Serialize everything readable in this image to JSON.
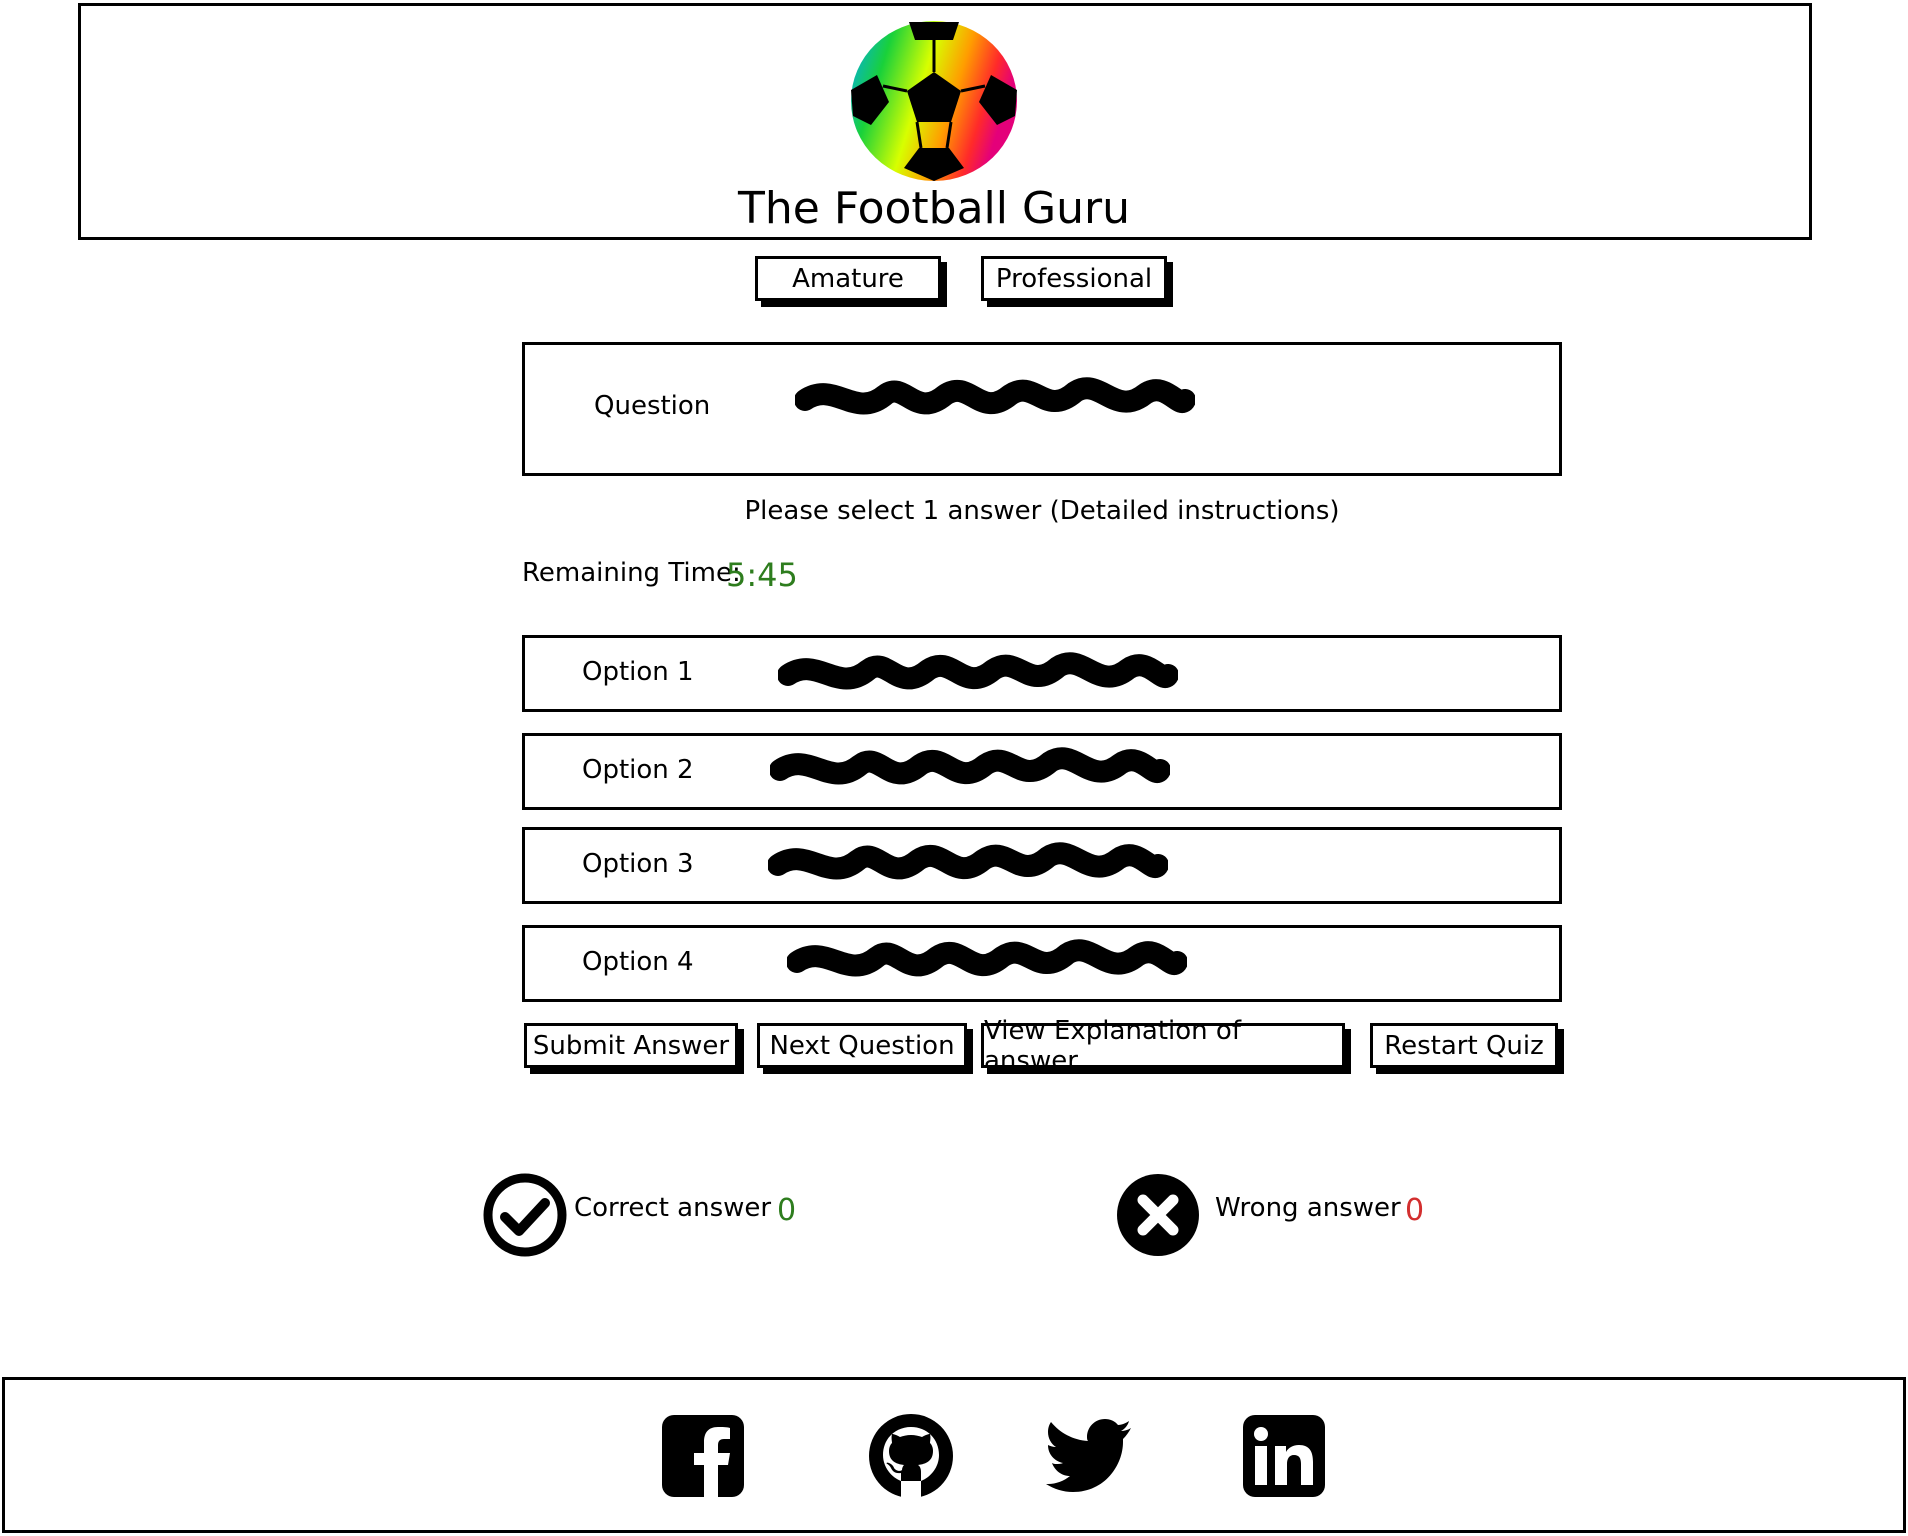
{
  "header": {
    "title": "The Football Guru",
    "logo_icon": "football-icon"
  },
  "levels": {
    "amateur_label": "Amature",
    "professional_label": "Professional"
  },
  "question": {
    "label": "Question"
  },
  "instructions": "Please select 1 answer (Detailed instructions)",
  "timer": {
    "label": "Remaining Time:",
    "value": "5:45",
    "color": "#2e7d1e"
  },
  "options": [
    {
      "label": "Option 1"
    },
    {
      "label": "Option 2"
    },
    {
      "label": "Option 3"
    },
    {
      "label": "Option 4"
    }
  ],
  "actions": {
    "submit": "Submit Answer",
    "next": "Next Question",
    "explanation": "View Explanation of answer",
    "restart": "Restart Quiz"
  },
  "score": {
    "correct_label": "Correct answer",
    "correct_value": "0",
    "correct_color": "#2e7d1e",
    "wrong_label": "Wrong answer",
    "wrong_value": "0",
    "wrong_color": "#d32f2f"
  },
  "footer": {
    "social": [
      "facebook-icon",
      "github-icon",
      "twitter-icon",
      "linkedin-icon"
    ]
  }
}
